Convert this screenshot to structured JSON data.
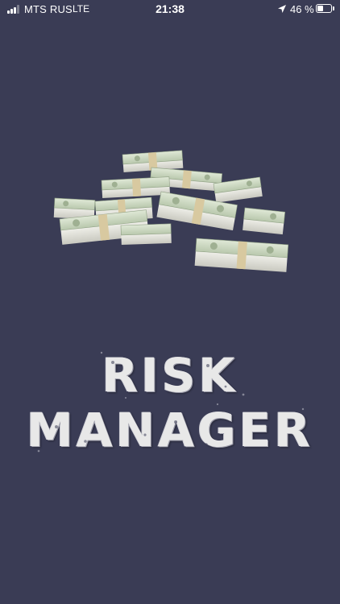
{
  "status_bar": {
    "carrier": "MTS RUS",
    "network": "LTE",
    "time": "21:38",
    "battery_percent_label": "46 %",
    "battery_level": 0.46,
    "signal_bars_active": 3,
    "signal_bars_total": 4,
    "icons": [
      "signal-icon",
      "location-arrow-icon",
      "battery-icon"
    ]
  },
  "splash": {
    "title_line1": "RISK",
    "title_line2": "MANAGER",
    "image": "money-stacks-illustration"
  },
  "colors": {
    "background": "#3a3c55",
    "status_text": "#ffffff",
    "title_text": "#e8e8e8",
    "banknote_green": "#bfcfb5",
    "band_tan": "#d8c9a0"
  }
}
